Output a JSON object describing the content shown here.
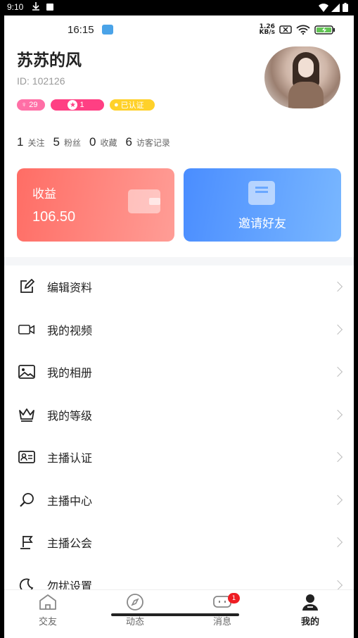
{
  "system_status": {
    "time": "9:10"
  },
  "inner_status": {
    "time": "16:15",
    "speed_top": "1.26",
    "speed_unit": "KB/s"
  },
  "profile": {
    "name": "苏苏的风",
    "id": "ID: 102126",
    "gender_age": "29",
    "level": "1",
    "verified": "已认证"
  },
  "stats": [
    {
      "num": "1",
      "label": "关注"
    },
    {
      "num": "5",
      "label": "粉丝"
    },
    {
      "num": "0",
      "label": "收藏"
    },
    {
      "num": "6",
      "label": "访客记录"
    }
  ],
  "income_card": {
    "label": "收益",
    "value": "106.50"
  },
  "invite_card": {
    "label": "邀请好友"
  },
  "menu": [
    {
      "label": "编辑资料",
      "icon": "edit-icon"
    },
    {
      "label": "我的视频",
      "icon": "video-camera-icon"
    },
    {
      "label": "我的相册",
      "icon": "photo-album-icon"
    },
    {
      "label": "我的等级",
      "icon": "crown-icon"
    },
    {
      "label": "主播认证",
      "icon": "id-card-icon"
    },
    {
      "label": "主播中心",
      "icon": "search-icon"
    },
    {
      "label": "主播公会",
      "icon": "flag-icon"
    },
    {
      "label": "勿扰设置",
      "icon": "moon-icon"
    }
  ],
  "tabs": [
    {
      "label": "交友",
      "icon": "home-icon"
    },
    {
      "label": "动态",
      "icon": "compass-icon"
    },
    {
      "label": "消息",
      "icon": "chat-icon",
      "badge": "1"
    },
    {
      "label": "我的",
      "icon": "profile-icon",
      "active": true
    }
  ],
  "colors": {
    "income": "#ff6d65",
    "invite": "#4a8dff",
    "badge_red": "#ee1d23",
    "verified": "#ffd12a"
  }
}
